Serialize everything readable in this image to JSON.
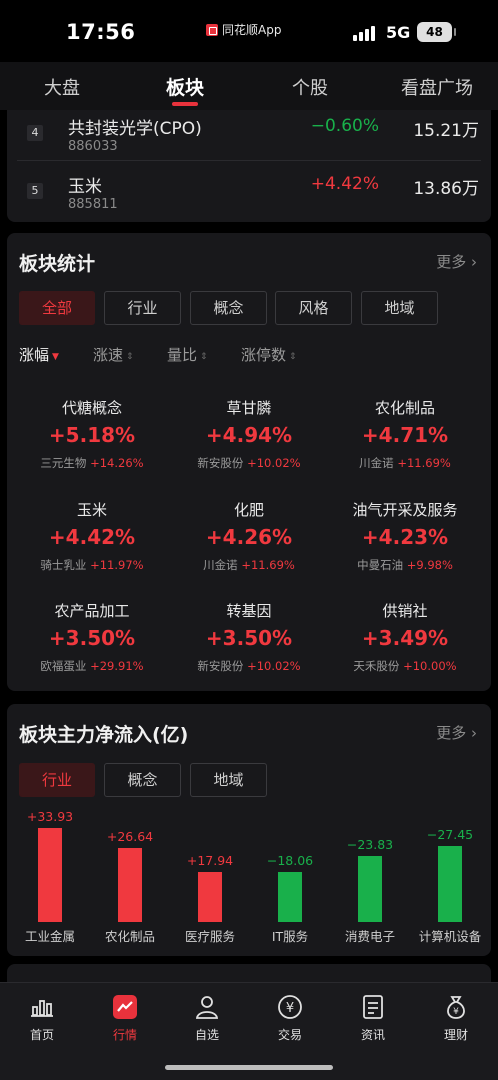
{
  "status_bar": {
    "time": "17:56",
    "app_name": "同花顺App",
    "network": "5G",
    "battery": "48"
  },
  "top_tabs": [
    {
      "label": "大盘"
    },
    {
      "label": "板块",
      "active": true
    },
    {
      "label": "个股"
    },
    {
      "label": "看盘广场"
    }
  ],
  "ranking": [
    {
      "rank": "4",
      "name": "共封装光学(CPO)",
      "code": "886033",
      "change": "−0.60%",
      "direction": "down",
      "amount": "15.21万"
    },
    {
      "rank": "5",
      "name": "玉米",
      "code": "885811",
      "change": "+4.42%",
      "direction": "up",
      "amount": "13.86万"
    }
  ],
  "sector_stats": {
    "title": "板块统计",
    "more": "更多",
    "filters": [
      {
        "label": "全部",
        "active": true
      },
      {
        "label": "行业"
      },
      {
        "label": "概念"
      },
      {
        "label": "风格"
      },
      {
        "label": "地域"
      }
    ],
    "sorts": [
      {
        "label": "涨幅",
        "active": true
      },
      {
        "label": "涨速"
      },
      {
        "label": "量比"
      },
      {
        "label": "涨停数"
      }
    ],
    "items": [
      {
        "name": "代糖概念",
        "change": "+5.18%",
        "leader": "三元生物",
        "leader_change": "+14.26%"
      },
      {
        "name": "草甘膦",
        "change": "+4.94%",
        "leader": "新安股份",
        "leader_change": "+10.02%"
      },
      {
        "name": "农化制品",
        "change": "+4.71%",
        "leader": "川金诺",
        "leader_change": "+11.69%"
      },
      {
        "name": "玉米",
        "change": "+4.42%",
        "leader": "骑士乳业",
        "leader_change": "+11.97%"
      },
      {
        "name": "化肥",
        "change": "+4.26%",
        "leader": "川金诺",
        "leader_change": "+11.69%"
      },
      {
        "name": "油气开采及服务",
        "change": "+4.23%",
        "leader": "中曼石油",
        "leader_change": "+9.98%"
      },
      {
        "name": "农产品加工",
        "change": "+3.50%",
        "leader": "欧福蛋业",
        "leader_change": "+29.91%"
      },
      {
        "name": "转基因",
        "change": "+3.50%",
        "leader": "新安股份",
        "leader_change": "+10.02%"
      },
      {
        "name": "供销社",
        "change": "+3.49%",
        "leader": "天禾股份",
        "leader_change": "+10.00%"
      }
    ]
  },
  "net_inflow": {
    "title": "板块主力净流入(亿)",
    "more": "更多",
    "filters": [
      {
        "label": "行业",
        "active": true
      },
      {
        "label": "概念"
      },
      {
        "label": "地域"
      }
    ]
  },
  "chart_data": {
    "type": "bar",
    "categories": [
      "工业金属",
      "农化制品",
      "医疗服务",
      "IT服务",
      "消费电子",
      "计算机设备"
    ],
    "values": [
      33.93,
      26.64,
      17.94,
      -18.06,
      -23.83,
      -27.45
    ],
    "value_labels": [
      "+33.93",
      "+26.64",
      "+17.94",
      "−18.06",
      "−23.83",
      "−27.45"
    ],
    "colors": {
      "positive": "#f0393f",
      "negative": "#19b04b"
    }
  },
  "bottom_nav": [
    {
      "label": "首页",
      "icon": "home-chart-icon"
    },
    {
      "label": "行情",
      "icon": "market-icon",
      "active": true
    },
    {
      "label": "自选",
      "icon": "watchlist-person-icon"
    },
    {
      "label": "交易",
      "icon": "yen-trade-icon"
    },
    {
      "label": "资讯",
      "icon": "news-document-icon"
    },
    {
      "label": "理财",
      "icon": "money-bag-icon"
    }
  ],
  "colors": {
    "up": "#f0393f",
    "down": "#19b04b",
    "accent": "#e8323c",
    "background": "#000000",
    "card": "#18181b"
  }
}
